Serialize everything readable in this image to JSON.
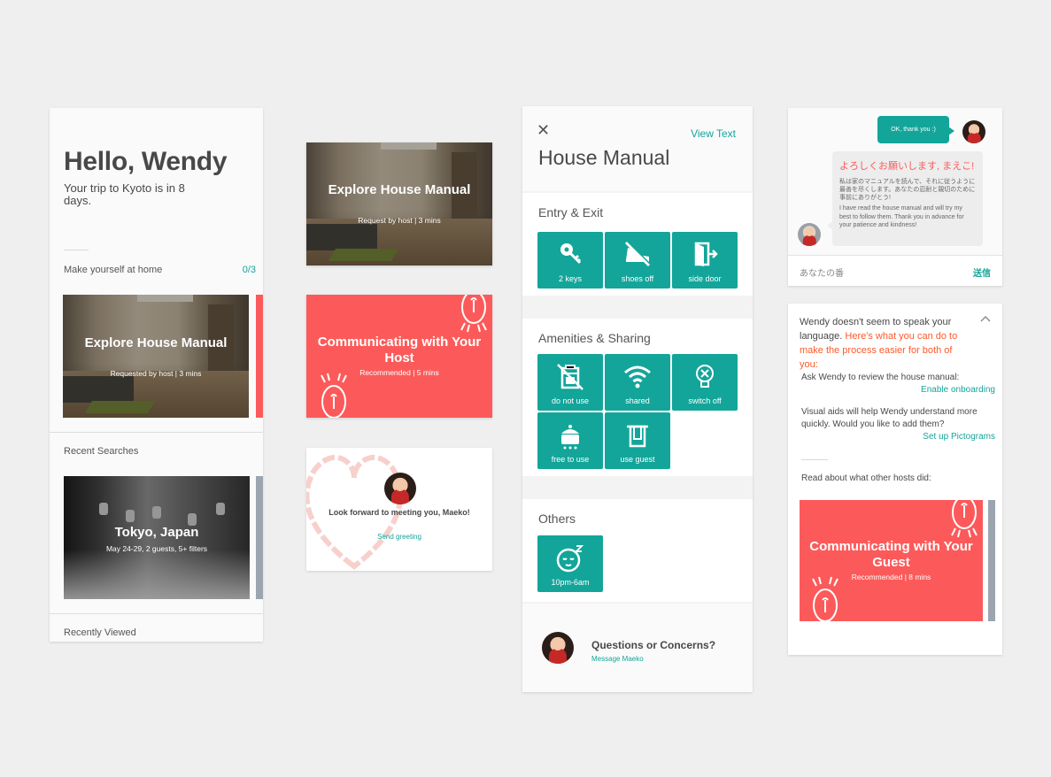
{
  "colors": {
    "teal": "#13a59a",
    "coral": "#fc5a5a",
    "orange_text": "#fc5a2a",
    "background": "#efeff0"
  },
  "home": {
    "greeting": "Hello, Wendy",
    "trip_text": "Your trip to Kyoto is in 8 days.",
    "section_home": "Make yourself at home",
    "section_home_count": "0/3",
    "explore_card": {
      "title": "Explore House Manual",
      "subtitle": "Requested by host | 3 mins"
    },
    "recent_searches_label": "Recent Searches",
    "search_card": {
      "title": "Tokyo, Japan",
      "subtitle": "May 24-29, 2 guests, 5+ filters"
    },
    "recently_viewed_label": "Recently Viewed"
  },
  "cards": {
    "explore": {
      "title": "Explore House Manual",
      "subtitle": "Request by host | 3 mins"
    },
    "communicating_host": {
      "title": "Communicating with Your Host",
      "subtitle": "Recommended | 5 mins"
    },
    "greeting": {
      "message": "Look forward to meeting you, Maeko!",
      "link": "Send greeting"
    }
  },
  "manual": {
    "close_icon": "close-icon",
    "view_text": "View Text",
    "title": "House Manual",
    "sections": [
      {
        "title": "Entry & Exit",
        "tiles": [
          {
            "label": "2 keys",
            "icon": "key-icon"
          },
          {
            "label": "shoes off",
            "icon": "no-shoes-icon"
          },
          {
            "label": "side door",
            "icon": "door-exit-icon"
          }
        ]
      },
      {
        "title": "Amenities & Sharing",
        "tiles": [
          {
            "label": "do not use",
            "icon": "grill-crossed-icon"
          },
          {
            "label": "shared",
            "icon": "wifi-icon"
          },
          {
            "label": "switch off",
            "icon": "lightbulb-icon"
          },
          {
            "label": "free to use",
            "icon": "rice-cooker-icon"
          },
          {
            "label": "use guest",
            "icon": "towel-icon"
          }
        ]
      },
      {
        "title": "Others",
        "tiles": [
          {
            "label": "10pm-6am",
            "icon": "sleeping-face-icon"
          }
        ]
      }
    ],
    "questions": {
      "title": "Questions or Concerns?",
      "link": "Message Maeko"
    }
  },
  "chat": {
    "outgoing": "OK, thank you :)",
    "incoming_headline": "よろしくお願いします, まえこ!",
    "incoming_jp": "私は家のマニュアルを読んで、それに従うように最善を尽くします。あなたの忍耐と親切のために事前にありがとう!",
    "incoming_en": "I have read the house manual and will try my best to follow them. Thank you in advance for your patience and kindness!",
    "input_placeholder": "あなたの番",
    "send_label": "送信"
  },
  "tips": {
    "lead_plain": "Wendy doesn't seem to speak your language. ",
    "lead_highlight": "Here's what you can do to make the process easier for both of you:",
    "item1_text": "Ask Wendy to review the house manual:",
    "item1_action": "Enable onboarding",
    "item2_text": "Visual aids will help Wendy understand more quickly. Would you like to add them?",
    "item2_action": "Set up Pictograms",
    "read_more": "Read about what other hosts did:",
    "guest_card": {
      "title": "Communicating with Your Guest",
      "subtitle": "Recommended | 8 mins"
    }
  }
}
